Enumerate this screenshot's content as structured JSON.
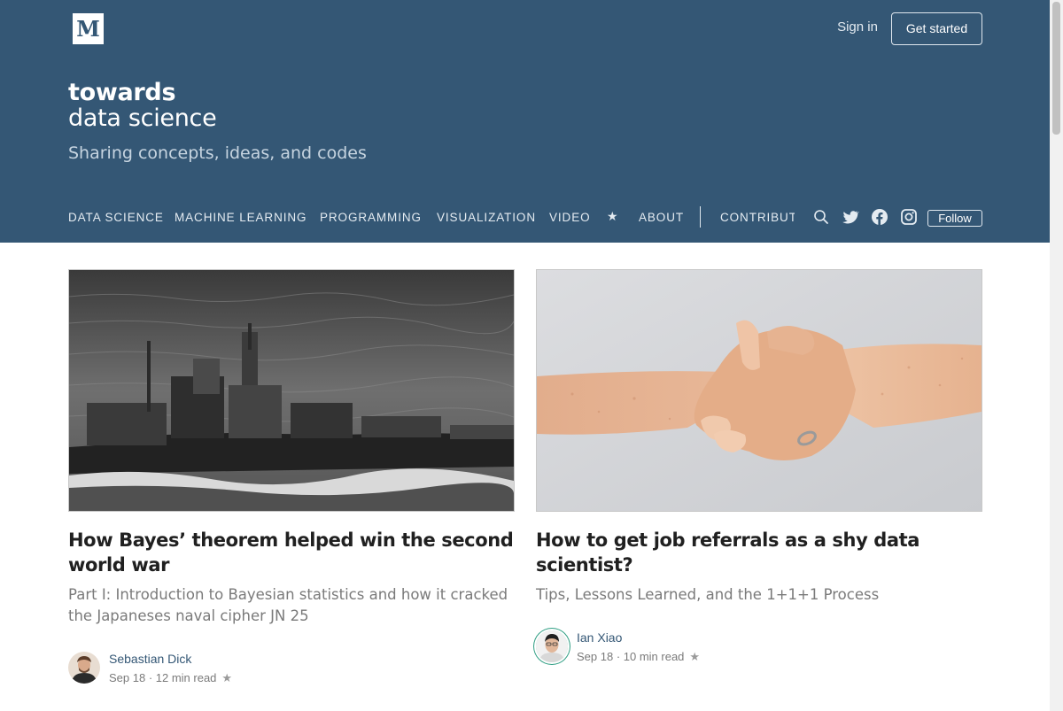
{
  "header": {
    "logo_letter": "M",
    "sign_in": "Sign in",
    "get_started": "Get started",
    "brand_bold": "towards",
    "brand_light": "data science",
    "tagline": "Sharing concepts, ideas, and codes"
  },
  "nav": {
    "items": [
      "DATA SCIENCE",
      "MACHINE LEARNING",
      "PROGRAMMING",
      "VISUALIZATION",
      "VIDEO"
    ],
    "star": "★",
    "about": "ABOUT",
    "contribute": "CONTRIBUTE",
    "follow": "Follow",
    "icons": [
      "search-icon",
      "twitter-icon",
      "facebook-icon",
      "instagram-icon"
    ]
  },
  "articles": [
    {
      "title": "How Bayes’ theorem helped win the second world war",
      "subtitle": "Part I: Introduction to Bayesian statistics and how it cracked the Japaneses naval cipher JN 25",
      "author": "Sebastian Dick",
      "date": "Sep 18",
      "read_time": "12 min read",
      "image": "battleship-photo"
    },
    {
      "title": "How to get job referrals as a shy data scientist?",
      "subtitle": "Tips, Lessons Learned, and the 1+1+1 Process",
      "author": "Ian Xiao",
      "date": "Sep 18",
      "read_time": "10 min read",
      "image": "handshake-photo"
    }
  ],
  "colors": {
    "header_bg": "#345775",
    "accent_ring": "#2f9e83"
  }
}
